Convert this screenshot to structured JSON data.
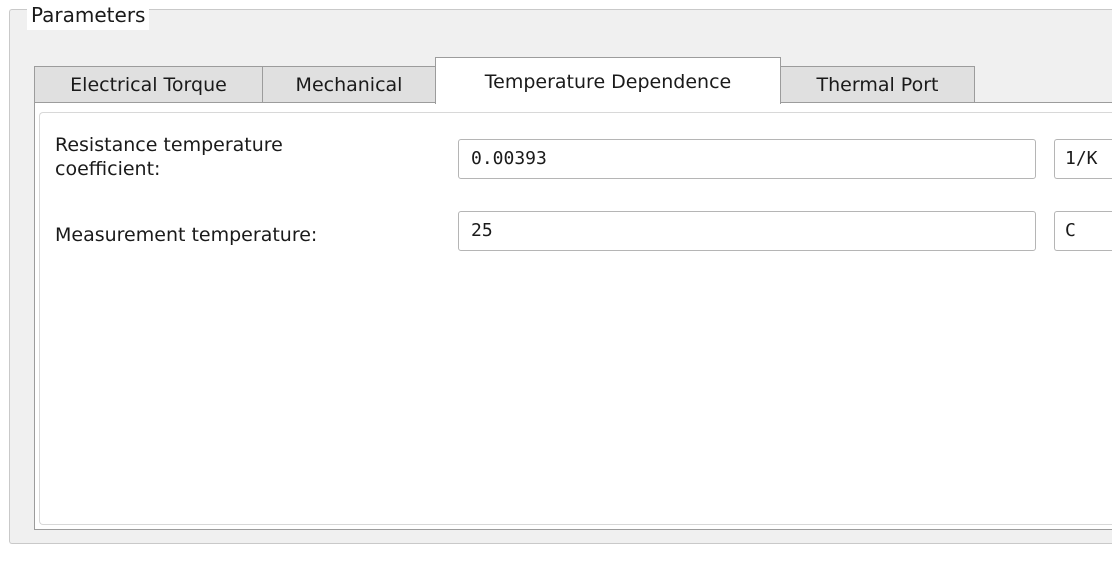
{
  "group": {
    "title": "Parameters"
  },
  "tabs": [
    {
      "label": "Electrical Torque",
      "active": false
    },
    {
      "label": "Mechanical",
      "active": false
    },
    {
      "label": "Temperature Dependence",
      "active": true
    },
    {
      "label": "Thermal Port",
      "active": false
    }
  ],
  "params": [
    {
      "label_line1": "Resistance temperature",
      "label_line2": "coefficient:",
      "value": "0.00393",
      "unit": "1/K"
    },
    {
      "label": "Measurement temperature:",
      "value": "25",
      "unit": "C"
    }
  ]
}
